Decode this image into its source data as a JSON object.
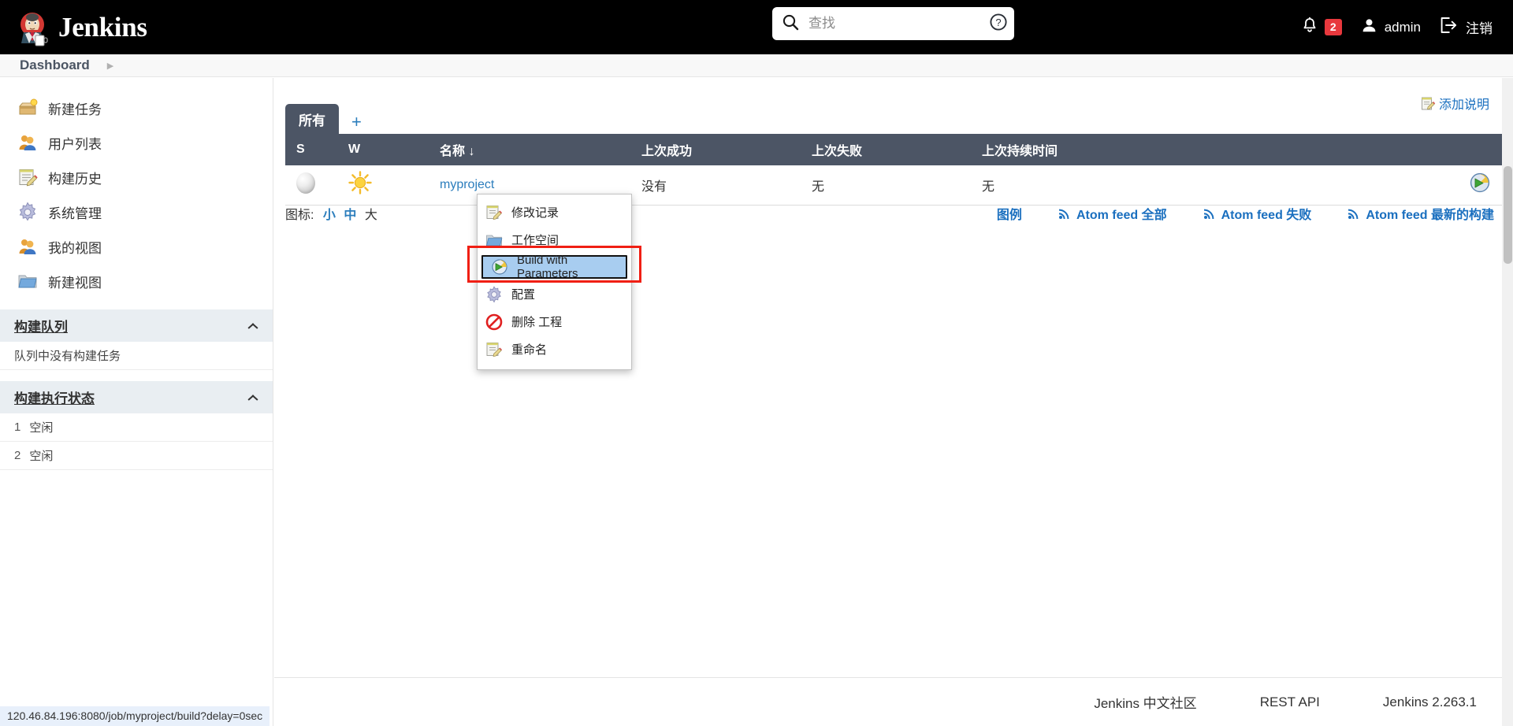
{
  "header": {
    "brand": "Jenkins",
    "logo_icon": "jenkins-butler-logo",
    "search": {
      "icon": "search-icon",
      "placeholder": "查找",
      "value": "",
      "help_icon": "help-circle-icon"
    },
    "notifications": {
      "icon": "bell-icon",
      "count": "2"
    },
    "user": {
      "icon": "person-icon",
      "name": "admin"
    },
    "logout": {
      "icon": "logout-icon",
      "label": "注销"
    }
  },
  "breadcrumb": {
    "items": [
      "Dashboard"
    ],
    "separator_icon": "chevron-right-icon"
  },
  "sidebar": {
    "tasks": [
      {
        "icon": "new-item-box-icon",
        "label": "新建任务"
      },
      {
        "icon": "people-icon",
        "label": "用户列表"
      },
      {
        "icon": "notepad-pencil-icon",
        "label": "构建历史"
      },
      {
        "icon": "gear-icon",
        "label": "系统管理"
      },
      {
        "icon": "people-icon",
        "label": "我的视图"
      },
      {
        "icon": "folder-icon",
        "label": "新建视图"
      }
    ],
    "build_queue": {
      "title": "构建队列",
      "collapse_icon": "chevron-up-icon",
      "empty_text": "队列中没有构建任务"
    },
    "build_executor": {
      "title": "构建执行状态",
      "collapse_icon": "chevron-up-icon",
      "executors": [
        {
          "num": "1",
          "state": "空闲"
        },
        {
          "num": "2",
          "state": "空闲"
        }
      ]
    }
  },
  "main": {
    "add_description": {
      "icon": "edit-note-icon",
      "label": "添加说明"
    },
    "tabs": {
      "active": "所有",
      "add_label": "+"
    },
    "table": {
      "columns": [
        "S",
        "W",
        "名称 ↓",
        "上次成功",
        "上次失败",
        "上次持续时间",
        ""
      ],
      "rows": [
        {
          "status_icon": "grey-ball-icon",
          "weather_icon": "sunny-icon",
          "name": "myproject",
          "last_success": "没有",
          "last_failure": "无",
          "last_duration": "无",
          "action_icon": "build-with-parameters-icon"
        }
      ]
    },
    "icon_sizes": {
      "label": "图标:",
      "options": [
        "小",
        "中",
        "大"
      ],
      "selected": "大"
    },
    "feeds": [
      {
        "icon": "legend-icon",
        "label": "图例",
        "has_rss": false
      },
      {
        "icon": "rss-icon",
        "label": "Atom feed 全部",
        "has_rss": true
      },
      {
        "icon": "rss-icon",
        "label": "Atom feed 失败",
        "has_rss": true
      },
      {
        "icon": "rss-icon",
        "label": "Atom feed 最新的构建",
        "has_rss": true
      }
    ]
  },
  "context_menu": {
    "items": [
      {
        "icon": "notepad-pencil-icon",
        "label": "修改记录",
        "highlighted": false
      },
      {
        "icon": "folder-icon",
        "label": "工作空间",
        "highlighted": false
      },
      {
        "icon": "build-with-parameters-icon",
        "label": "Build with Parameters",
        "highlighted": true
      },
      {
        "icon": "gear-icon",
        "label": "配置",
        "highlighted": false
      },
      {
        "icon": "delete-prohibited-icon",
        "label": "删除 工程",
        "highlighted": false
      },
      {
        "icon": "notepad-pencil-icon",
        "label": "重命名",
        "highlighted": false
      }
    ],
    "highlight_border_color": "#f01f14",
    "highlight_bg_color": "#a8cdf0"
  },
  "footer": {
    "links": [
      "Jenkins 中文社区",
      "REST API"
    ],
    "version": "Jenkins 2.263.1"
  },
  "status_bar": {
    "url": "120.46.84.196:8080/job/myproject/build?delay=0sec"
  },
  "colors": {
    "header_bg": "#000000",
    "table_header_bg": "#4c5565",
    "link_blue": "#2b7dbc",
    "badge_red": "#e8383d",
    "section_bg": "#e9eef2"
  }
}
